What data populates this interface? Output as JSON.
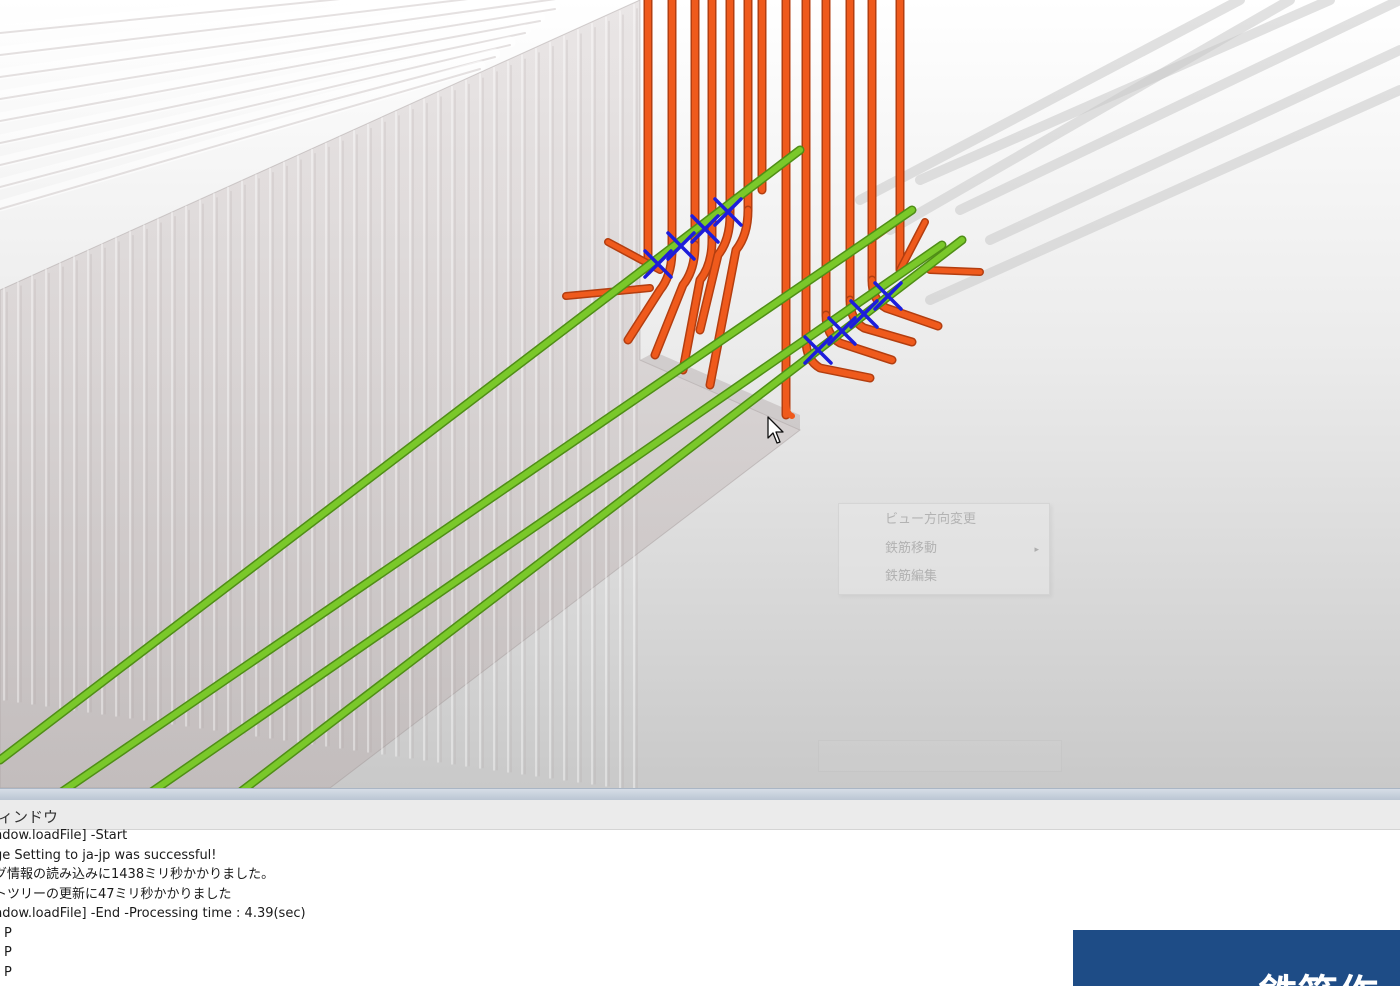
{
  "colors": {
    "green_rebar": "#7ac82a",
    "orange_rebar": "#ef5a1c",
    "blue_marker": "#1d1ddb",
    "banner_bg": "#1e4c86",
    "background_top": "#ffffff",
    "background_bottom": "#c9c9c9"
  },
  "context_menu": {
    "items": [
      {
        "label": "ビュー方向変更"
      },
      {
        "label": "鉄筋移動",
        "has_submenu": true
      },
      {
        "label": "鉄筋編集"
      }
    ],
    "submenu_glyph": "▸"
  },
  "output_panel": {
    "title": "ィンドウ",
    "lines": [
      "ndow.loadFile] -Start",
      "ge Setting to ja-jp was successful!",
      "グ情報の読み込みに1438ミリ秒かかりました。",
      "トツリーの更新に47ミリ秒かかりました",
      "ndow.loadFile] -End -Processing time : 4.39(sec)",
      "P",
      "P",
      "P"
    ]
  },
  "banner": {
    "text": "鉄筋作"
  },
  "icons": {
    "cursor": "mouse-pointer-icon",
    "marker": "x-marker-icon"
  }
}
